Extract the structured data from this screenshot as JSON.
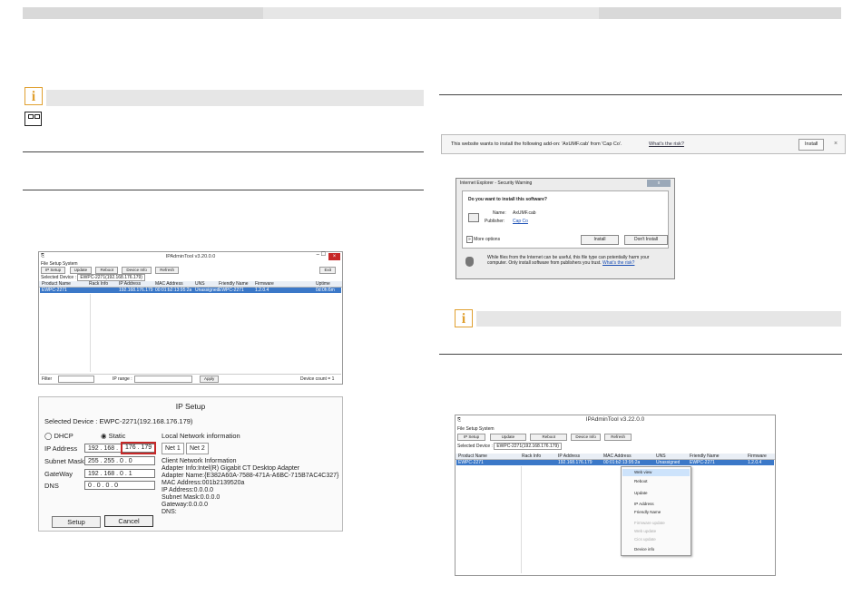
{
  "ip_admin_small": {
    "title": "IPAdminTool v3.20.0.0",
    "menu": [
      "File",
      "Setup",
      "System"
    ],
    "toolbar": {
      "ip_setup": "IP Setup",
      "update": "Update",
      "reboot": "Reboot",
      "device_info": "Device Info",
      "refresh": "Refresh",
      "exit": "Exit"
    },
    "selected_label": "Selected Device :",
    "selected_value": "EWPC-2271(192.168.176.179)",
    "columns": [
      "Product Name",
      "Rack Info",
      "IP Address",
      "MAC Address",
      "UNS",
      "Friendly Name",
      "Firmware",
      "Uptime"
    ],
    "row": [
      "EWPC-2271",
      "",
      "192.168.176.179",
      "00:01:b2:13:95:2a",
      "Unassigned",
      "EWPC-2271",
      "1.2.0.4",
      "0d:0h:6m"
    ],
    "footer": {
      "filter": "Filter",
      "ip_range": "IP range :",
      "apply": "Apply",
      "device_count": "Device count = 1"
    }
  },
  "ip_setup": {
    "title": "IP Setup",
    "selected_device": "Selected Device : EWPC-2271(192.168.176.179)",
    "dhcp": "DHCP",
    "static": "Static",
    "local_network": "Local Network information",
    "labels": {
      "ip": "IP Address",
      "subnet": "Subnet Mask",
      "gateway": "GateWay",
      "dns": "DNS"
    },
    "ip_prefix": "192 . 168 .",
    "ip_suffix": "176 . 179",
    "subnet": "255 . 255 .  0  .  0",
    "gateway": "192 . 168 .  0  .  1",
    "dns": "0  .  0  .  0  .  0",
    "tabs": [
      "Net 1",
      "Net 2"
    ],
    "client_info": [
      "Client Network Information",
      "Adapter Info:Intel(R) Gigabit CT Desktop Adapter",
      "Adapter Name:{E382A60A-7588-471A-A6BC-715B7AC4C327}",
      "MAC Address:001b2139520a",
      "IP Address:0.0.0.0",
      "Subnet Mask:0.0.0.0",
      "Gateway:0.0.0.0",
      "DNS:"
    ],
    "setup_btn": "Setup",
    "cancel_btn": "Cancel"
  },
  "ie_bar": {
    "text": "This website wants to install the following add-on: 'AxUMF.cab' from 'Cap Co'.",
    "risk": "What's the risk?",
    "install": "Install",
    "close": "×"
  },
  "ie_dialog": {
    "title": "Internet Explorer - Security Warning",
    "question": "Do you want to install this software?",
    "name_label": "Name:",
    "name_value": "AxUMF.cab",
    "publisher_label": "Publisher:",
    "publisher_value": "Cap Co",
    "more_options": "More options",
    "install": "Install",
    "dont_install": "Don't Install",
    "warning": "While files from the Internet can be useful, this file type can potentially harm your computer. Only install software from publishers you trust.",
    "risk_link": "What's the risk?"
  },
  "ip_admin_large": {
    "title": "IPAdminTool v3.22.0.0",
    "menu": [
      "File",
      "Setup",
      "System"
    ],
    "toolbar": {
      "ip_setup": "IP Setup",
      "update": "Update",
      "reboot": "Reboot",
      "device_info": "Device Info",
      "refresh": "Refresh"
    },
    "selected_label": "Selected Device :",
    "selected_value": "EWPC-2271(192.168.176.179)",
    "columns": [
      "Product Name",
      "Rack Info",
      "IP Address",
      "MAC Address",
      "UNS",
      "Friendly Name",
      "Firmware"
    ],
    "row": [
      "EWPC-2271",
      "",
      "192.168.176.179",
      "00:01:b2:13:95:2a",
      "Unassigned",
      "EWPC-2271",
      "1.2.0.4"
    ],
    "context_menu": [
      "Web view",
      "Reboot",
      "Update",
      "IP Address",
      "Friendly Name",
      "Firmware update",
      "Web update",
      "Cics update",
      "Device info"
    ]
  }
}
